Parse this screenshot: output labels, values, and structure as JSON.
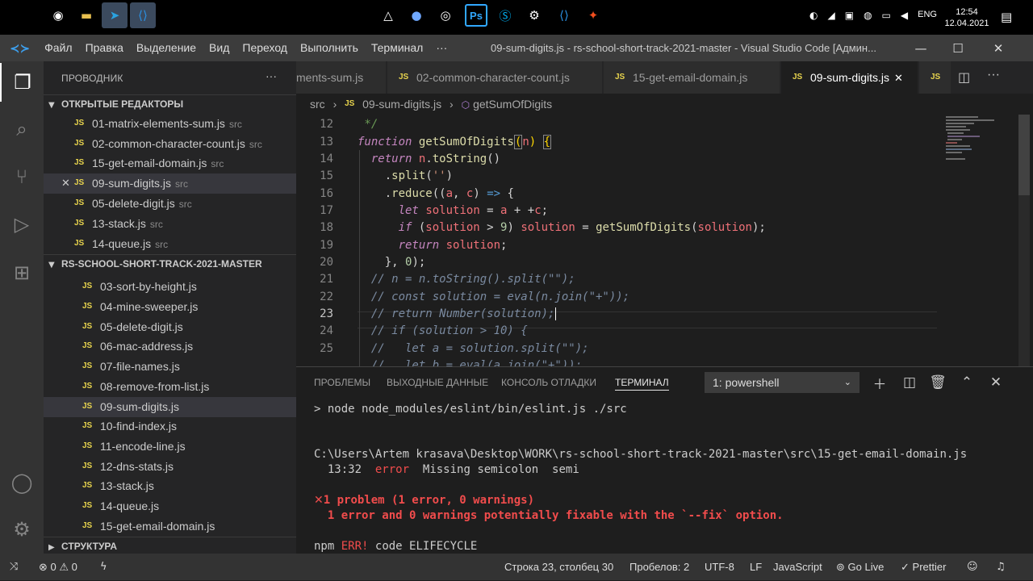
{
  "titlebar": {
    "menu": [
      "Файл",
      "Правка",
      "Выделение",
      "Вид",
      "Переход",
      "Выполнить",
      "Терминал",
      "···"
    ],
    "window_title": "09-sum-digits.js - rs-school-short-track-2021-master - Visual Studio Code [Админ..."
  },
  "tray": {
    "lang": "ENG",
    "time": "12:54",
    "date": "12.04.2021"
  },
  "sidebar": {
    "header": "ПРОВОДНИК",
    "more": "···",
    "open_editors_title": "ОТКРЫТЫЕ РЕДАКТОРЫ",
    "open_editors": [
      {
        "name": "01-matrix-elements-sum.js",
        "dir": "src"
      },
      {
        "name": "02-common-character-count.js",
        "dir": "src"
      },
      {
        "name": "15-get-email-domain.js",
        "dir": "src"
      },
      {
        "name": "09-sum-digits.js",
        "dir": "src"
      },
      {
        "name": "05-delete-digit.js",
        "dir": "src"
      },
      {
        "name": "13-stack.js",
        "dir": "src"
      },
      {
        "name": "14-queue.js",
        "dir": "src"
      }
    ],
    "project_title": "RS-SCHOOL-SHORT-TRACK-2021-MASTER",
    "files": [
      "03-sort-by-height.js",
      "04-mine-sweeper.js",
      "05-delete-digit.js",
      "06-mac-address.js",
      "07-file-names.js",
      "08-remove-from-list.js",
      "09-sum-digits.js",
      "10-find-index.js",
      "11-encode-line.js",
      "12-dns-stats.js",
      "13-stack.js",
      "14-queue.js",
      "15-get-email-domain.js"
    ],
    "outline_title": "СТРУКТУРА"
  },
  "tabs": [
    "ments-sum.js",
    "02-common-character-count.js",
    "15-get-email-domain.js",
    "09-sum-digits.js"
  ],
  "breadcrumb": {
    "folder": "src",
    "file": "09-sum-digits.js",
    "symbol": "getSumOfDigits",
    "sep": "›"
  },
  "editor": {
    "line_numbers": [
      "12",
      "13",
      "14",
      "15",
      "16",
      "17",
      "18",
      "19",
      "20",
      "21",
      "22",
      "23",
      "24",
      "25",
      ""
    ],
    "current_line": "23"
  },
  "panel": {
    "tabs": [
      "ПРОБЛЕМЫ",
      "ВЫХОДНЫЕ ДАННЫЕ",
      "КОНСОЛЬ ОТЛАДКИ",
      "ТЕРМИНАЛ"
    ],
    "terminal_select": "1: powershell",
    "lines": {
      "cmd": "> node node_modules/eslint/bin/eslint.js ./src",
      "path": "C:\\Users\\Artem krasava\\Desktop\\WORK\\rs-school-short-track-2021-master\\src\\15-get-email-domain.js",
      "pos": "13:32",
      "level": "error",
      "msg": "Missing semicolon  semi",
      "summary": "1 problem (1 error, 0 warnings)",
      "fixable": "1 error and 0 warnings potentially fixable with the `--fix` option.",
      "npm": "npm",
      "npm_err": "ERR!",
      "npm_rest": "code ELIFECYCLE"
    }
  },
  "status": {
    "errors": "0",
    "warnings": "0",
    "position": "Строка 23, столбец 30",
    "spaces": "Пробелов: 2",
    "encoding": "UTF-8",
    "eol": "LF",
    "language": "JavaScript",
    "golive": "Go Live",
    "prettier": "Prettier"
  }
}
